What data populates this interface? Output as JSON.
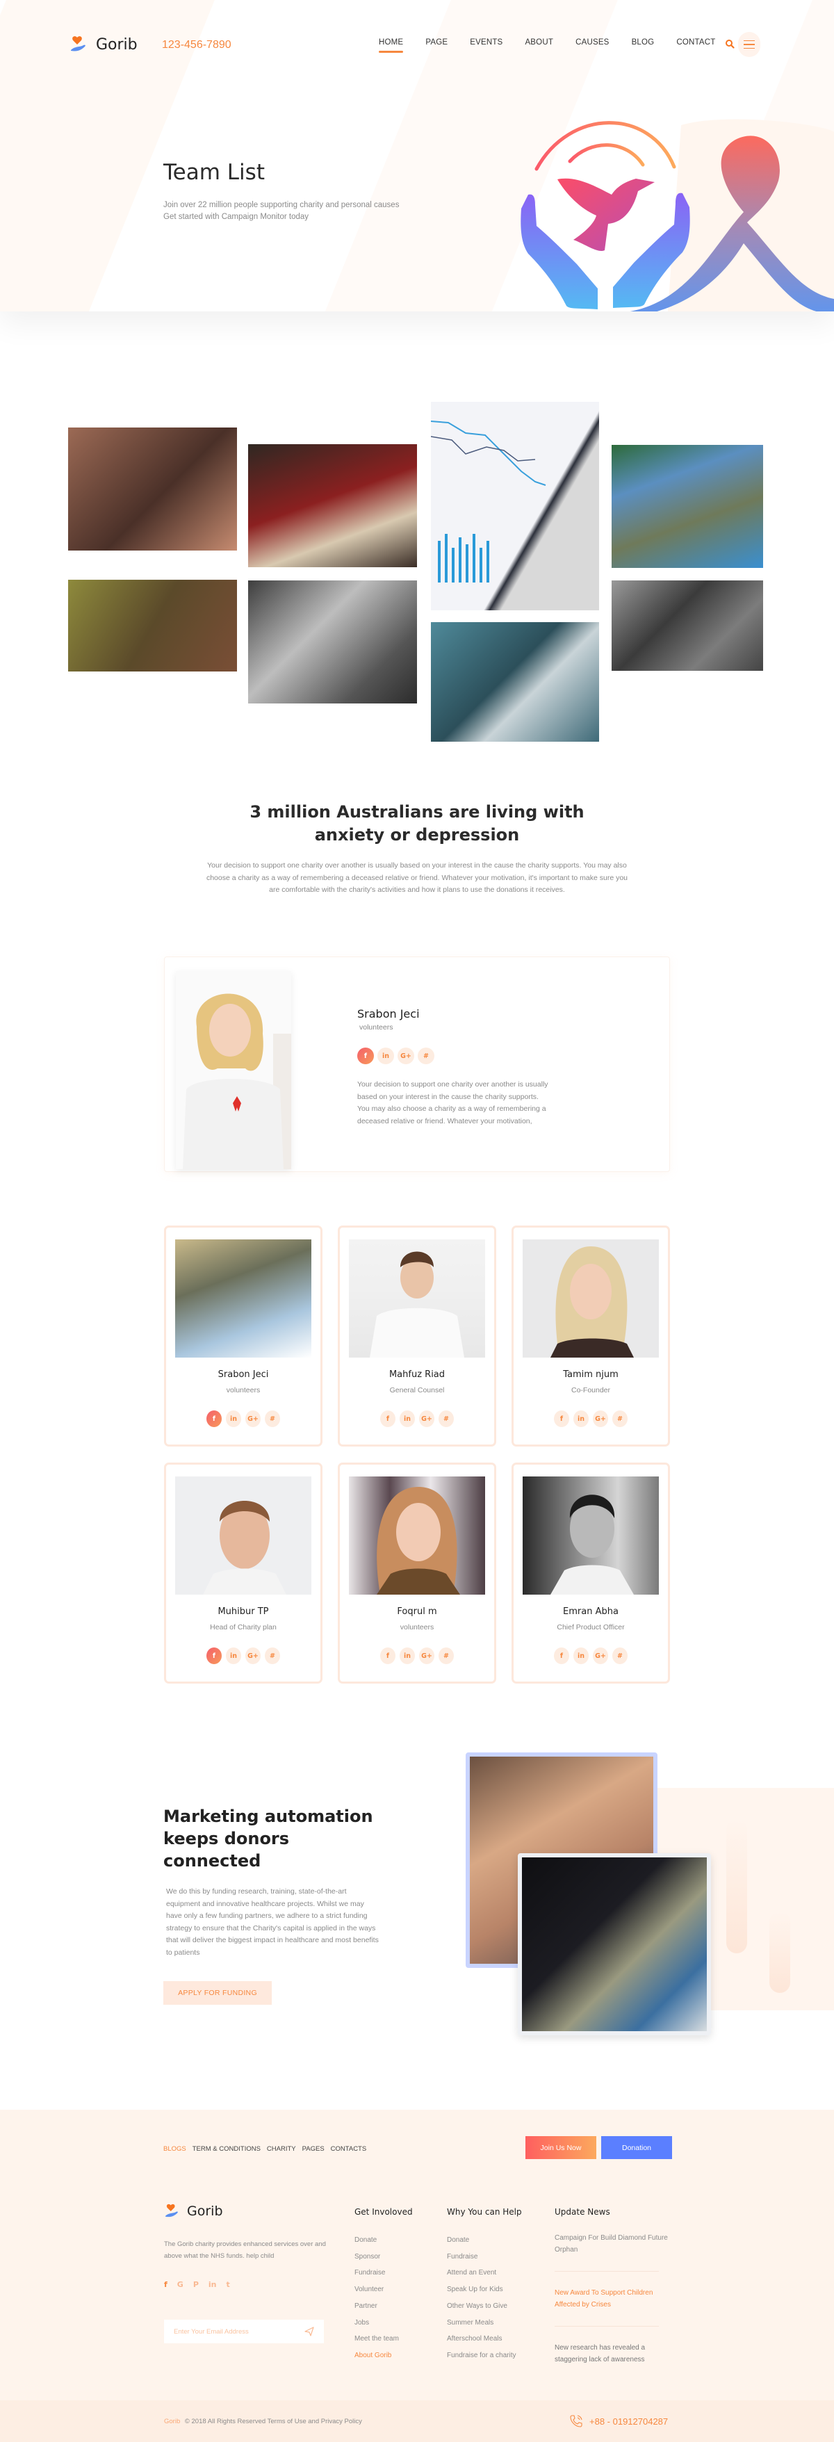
{
  "header": {
    "brand": "Gorib",
    "phone": "123-456-7890",
    "nav": [
      {
        "label": "HOME",
        "active": true
      },
      {
        "label": "PAGE"
      },
      {
        "label": "EVENTS"
      },
      {
        "label": "ABOUT"
      },
      {
        "label": "CAUSES"
      },
      {
        "label": "BLOG"
      },
      {
        "label": "CONTACT"
      }
    ],
    "icons": {
      "search": "search-icon",
      "menu": "hamburger-menu-icon"
    }
  },
  "hero": {
    "title": "Team List",
    "subtitle_line1": "Join over 22 million people supporting charity and personal causes",
    "subtitle_line2": "Get started with Campaign Monitor today",
    "illustration": "hands-holding-dove-and-awareness-ribbon"
  },
  "gallery": {
    "photos": [
      "crowd-on-city-street",
      "women-carrying-baskets",
      "business-chart-document",
      "children-at-tent-camp",
      "smiling-child-reaching-hands",
      "holding-baby-hand-bw",
      "coffee-mug-and-photos",
      "child-looking-up-bw"
    ]
  },
  "intro": {
    "title_line1": "3 million Australians are living with",
    "title_line2": "anxiety or depression",
    "body": "Your decision to support one charity over another is usually based on your interest in the cause the charity supports. You may also choose a charity as a way of remembering a deceased relative or friend. Whatever your motivation, it's important to make sure you are comfortable with the charity's activities and how it plans to use the donations it receives."
  },
  "featured": {
    "name": "Srabon Jeci",
    "role": "volunteers",
    "social": [
      "f",
      "in",
      "G+",
      "#"
    ],
    "body": "Your decision to support one charity over another is usually based on your interest in the cause the charity supports. You may also choose a charity as a way of remembering a deceased relative or friend. Whatever your motivation,"
  },
  "team": [
    {
      "name": "Srabon Jeci",
      "role": "volunteers"
    },
    {
      "name": "Mahfuz Riad",
      "role": "General Counsel"
    },
    {
      "name": "Tamim njum",
      "role": "Co-Founder"
    },
    {
      "name": "Muhibur TP",
      "role": "Head of Charity plan"
    },
    {
      "name": "Foqrul m",
      "role": "volunteers"
    },
    {
      "name": "Emran Abha",
      "role": "Chief Product Officer"
    }
  ],
  "social_labels": {
    "facebook": "f",
    "linkedin": "in",
    "google": "G+",
    "slack": "#"
  },
  "marketing": {
    "title": "Marketing automation keeps donors connected",
    "body": "We do this by funding research, training, state-of-the-art equipment and innovative healthcare projects. Whilst we may have only a few funding partners, we adhere to a strict funding strategy to ensure that the Charity's capital is applied in the ways that will deliver the biggest impact in healthcare and most benefits to patients",
    "button": "APPLY FOR FUNDING"
  },
  "footer": {
    "links": [
      "BLOGS",
      "TERM & CONDITIONS",
      "CHARITY",
      "PAGES",
      "CONTACTS"
    ],
    "join_button": "Join Us Now",
    "donation_button": "Donation",
    "brand": "Gorib",
    "description": "The Gorib charity provides enhanced services over and above what the NHS funds. help child",
    "social": [
      "f",
      "G",
      "P",
      "in",
      "t"
    ],
    "email_placeholder": "Enter Your Email Address",
    "get_involved": {
      "title": "Get Involoved",
      "items": [
        "Donate",
        "Sponsor",
        "Fundraise",
        "Volunteer",
        "Partner",
        "Jobs",
        "Meet the team",
        "About Gorib"
      ]
    },
    "why_help": {
      "title": "Why You can Help",
      "items": [
        "Donate",
        "Fundraise",
        "Attend an Event",
        "Speak Up for Kids",
        "Other Ways to Give",
        "Summer Meals",
        "Afterschool Meals",
        "Fundraise for a charity"
      ]
    },
    "news": {
      "title": "Update News",
      "items": [
        "Campaign For Build Diamond Future Orphan",
        "New Award To Support Children Affected by Crises",
        "New research has revealed a staggering lack of awareness"
      ]
    },
    "copyright_brand": "Gorib",
    "copyright": "© 2018 All Rights Reserved Terms of Use and Privacy Policy",
    "phone": "+88 - 01912704287"
  },
  "colors": {
    "accent": "#f6883f",
    "blue": "#5b7fff",
    "footer_bg": "#fef4ec"
  }
}
